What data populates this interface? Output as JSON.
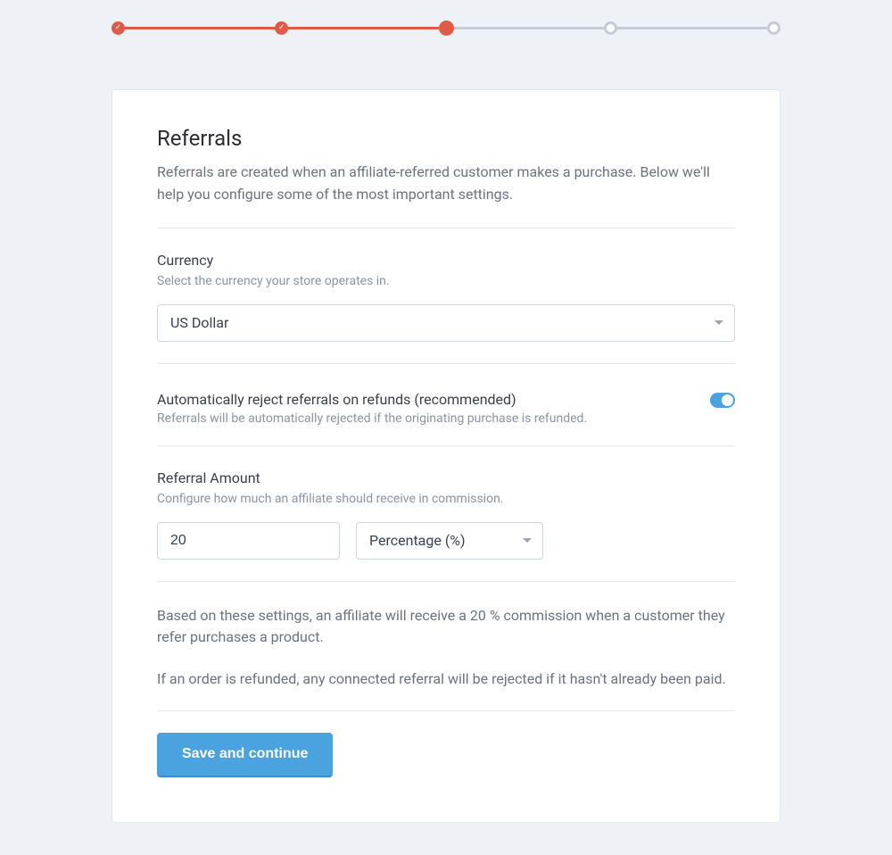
{
  "stepper": {
    "total": 5,
    "current": 3
  },
  "page": {
    "title": "Referrals",
    "description": "Referrals are created when an affiliate-referred customer makes a purchase. Below we'll help you configure some of the most important settings."
  },
  "currency": {
    "label": "Currency",
    "sub": "Select the currency your store operates in.",
    "value": "US Dollar"
  },
  "auto_reject": {
    "label": "Automatically reject referrals on refunds (recommended)",
    "sub": "Referrals will be automatically rejected if the originating purchase is refunded.",
    "enabled": true
  },
  "referral_amount": {
    "label": "Referral Amount",
    "sub": "Configure how much an affiliate should receive in commission.",
    "value": "20",
    "type_value": "Percentage (%)"
  },
  "summary": {
    "line1": "Based on these settings, an affiliate will receive a 20 % commission when a customer they refer purchases a product.",
    "line2": "If an order is refunded, any connected referral will be rejected if it hasn't already been paid."
  },
  "actions": {
    "save": "Save and continue"
  }
}
